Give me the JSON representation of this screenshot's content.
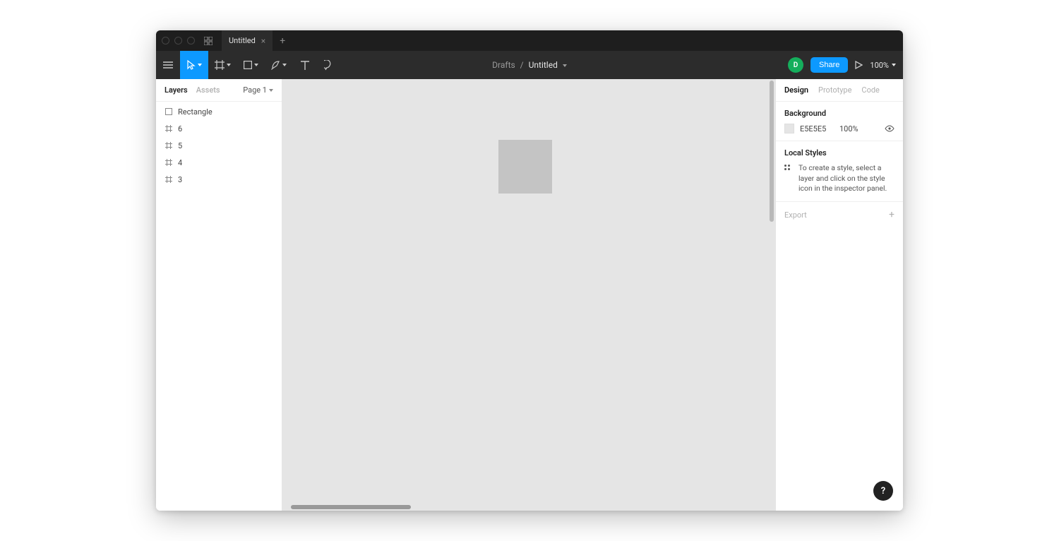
{
  "titlebar": {
    "tab_name": "Untitled"
  },
  "toolbar": {
    "breadcrumb_folder": "Drafts",
    "breadcrumb_file": "Untitled",
    "share_label": "Share",
    "avatar_initial": "D",
    "zoom": "100%"
  },
  "left_panel": {
    "tabs": {
      "layers": "Layers",
      "assets": "Assets"
    },
    "page_label": "Page 1",
    "layers": [
      {
        "type": "rect",
        "name": "Rectangle"
      },
      {
        "type": "frame",
        "name": "6"
      },
      {
        "type": "frame",
        "name": "5"
      },
      {
        "type": "frame",
        "name": "4"
      },
      {
        "type": "frame",
        "name": "3"
      }
    ]
  },
  "right_panel": {
    "tabs": {
      "design": "Design",
      "prototype": "Prototype",
      "code": "Code"
    },
    "background": {
      "title": "Background",
      "hex": "E5E5E5",
      "opacity": "100%"
    },
    "local_styles": {
      "title": "Local Styles",
      "message": "To create a style, select a layer and click on the style icon in the inspector panel."
    },
    "export_label": "Export"
  },
  "help_label": "?"
}
